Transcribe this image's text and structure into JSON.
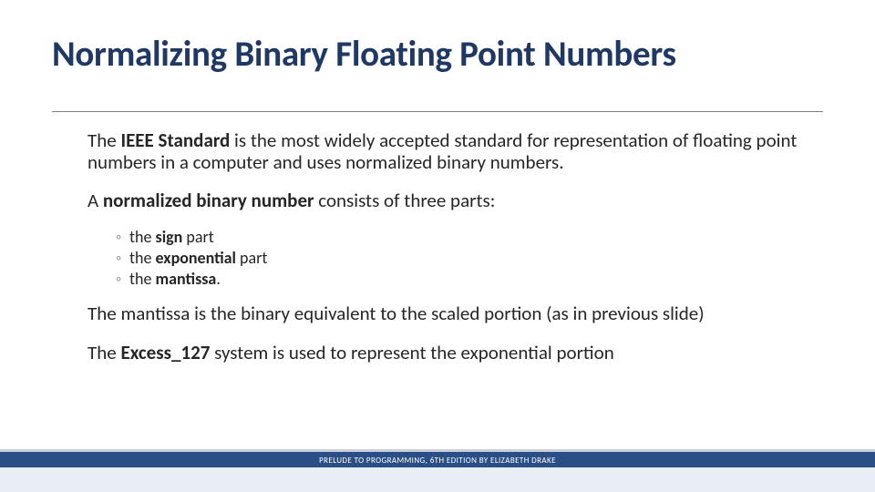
{
  "title": "Normalizing Binary Floating Point Numbers",
  "p1_a": "The ",
  "p1_b": "IEEE Standard",
  "p1_c": " is the most widely accepted standard for representation of floating point numbers in a computer and uses normalized binary numbers.",
  "p2_a": "A ",
  "p2_b": "normalized binary number",
  "p2_c": " consists of three parts:",
  "li1_a": "the ",
  "li1_b": "sign",
  "li1_c": " part",
  "li2_a": "the ",
  "li2_b": "exponential",
  "li2_c": " part",
  "li3_a": "the ",
  "li3_b": "mantissa",
  "li3_c": ".",
  "p3": "The mantissa is the binary equivalent to the scaled portion (as in previous slide)",
  "p4_a": "The ",
  "p4_b": "Excess_127",
  "p4_c": " system is used to represent the exponential portion",
  "footer": "PRELUDE TO PROGRAMMING, 6TH EDITION BY ELIZABETH DRAKE"
}
